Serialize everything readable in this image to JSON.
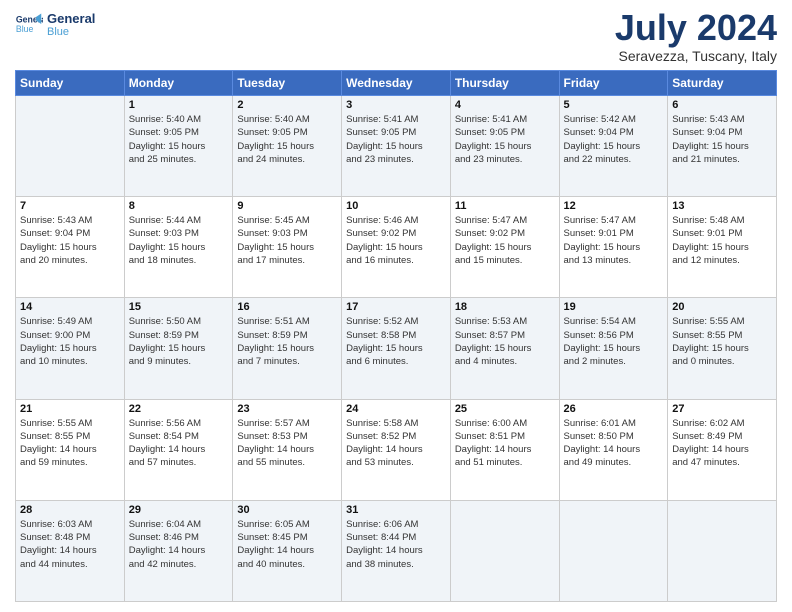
{
  "header": {
    "logo_line1": "General",
    "logo_line2": "Blue",
    "main_title": "July 2024",
    "subtitle": "Seravezza, Tuscany, Italy"
  },
  "weekdays": [
    "Sunday",
    "Monday",
    "Tuesday",
    "Wednesday",
    "Thursday",
    "Friday",
    "Saturday"
  ],
  "weeks": [
    [
      {
        "day": "",
        "info": ""
      },
      {
        "day": "1",
        "info": "Sunrise: 5:40 AM\nSunset: 9:05 PM\nDaylight: 15 hours\nand 25 minutes."
      },
      {
        "day": "2",
        "info": "Sunrise: 5:40 AM\nSunset: 9:05 PM\nDaylight: 15 hours\nand 24 minutes."
      },
      {
        "day": "3",
        "info": "Sunrise: 5:41 AM\nSunset: 9:05 PM\nDaylight: 15 hours\nand 23 minutes."
      },
      {
        "day": "4",
        "info": "Sunrise: 5:41 AM\nSunset: 9:05 PM\nDaylight: 15 hours\nand 23 minutes."
      },
      {
        "day": "5",
        "info": "Sunrise: 5:42 AM\nSunset: 9:04 PM\nDaylight: 15 hours\nand 22 minutes."
      },
      {
        "day": "6",
        "info": "Sunrise: 5:43 AM\nSunset: 9:04 PM\nDaylight: 15 hours\nand 21 minutes."
      }
    ],
    [
      {
        "day": "7",
        "info": "Sunrise: 5:43 AM\nSunset: 9:04 PM\nDaylight: 15 hours\nand 20 minutes."
      },
      {
        "day": "8",
        "info": "Sunrise: 5:44 AM\nSunset: 9:03 PM\nDaylight: 15 hours\nand 18 minutes."
      },
      {
        "day": "9",
        "info": "Sunrise: 5:45 AM\nSunset: 9:03 PM\nDaylight: 15 hours\nand 17 minutes."
      },
      {
        "day": "10",
        "info": "Sunrise: 5:46 AM\nSunset: 9:02 PM\nDaylight: 15 hours\nand 16 minutes."
      },
      {
        "day": "11",
        "info": "Sunrise: 5:47 AM\nSunset: 9:02 PM\nDaylight: 15 hours\nand 15 minutes."
      },
      {
        "day": "12",
        "info": "Sunrise: 5:47 AM\nSunset: 9:01 PM\nDaylight: 15 hours\nand 13 minutes."
      },
      {
        "day": "13",
        "info": "Sunrise: 5:48 AM\nSunset: 9:01 PM\nDaylight: 15 hours\nand 12 minutes."
      }
    ],
    [
      {
        "day": "14",
        "info": "Sunrise: 5:49 AM\nSunset: 9:00 PM\nDaylight: 15 hours\nand 10 minutes."
      },
      {
        "day": "15",
        "info": "Sunrise: 5:50 AM\nSunset: 8:59 PM\nDaylight: 15 hours\nand 9 minutes."
      },
      {
        "day": "16",
        "info": "Sunrise: 5:51 AM\nSunset: 8:59 PM\nDaylight: 15 hours\nand 7 minutes."
      },
      {
        "day": "17",
        "info": "Sunrise: 5:52 AM\nSunset: 8:58 PM\nDaylight: 15 hours\nand 6 minutes."
      },
      {
        "day": "18",
        "info": "Sunrise: 5:53 AM\nSunset: 8:57 PM\nDaylight: 15 hours\nand 4 minutes."
      },
      {
        "day": "19",
        "info": "Sunrise: 5:54 AM\nSunset: 8:56 PM\nDaylight: 15 hours\nand 2 minutes."
      },
      {
        "day": "20",
        "info": "Sunrise: 5:55 AM\nSunset: 8:55 PM\nDaylight: 15 hours\nand 0 minutes."
      }
    ],
    [
      {
        "day": "21",
        "info": "Sunrise: 5:55 AM\nSunset: 8:55 PM\nDaylight: 14 hours\nand 59 minutes."
      },
      {
        "day": "22",
        "info": "Sunrise: 5:56 AM\nSunset: 8:54 PM\nDaylight: 14 hours\nand 57 minutes."
      },
      {
        "day": "23",
        "info": "Sunrise: 5:57 AM\nSunset: 8:53 PM\nDaylight: 14 hours\nand 55 minutes."
      },
      {
        "day": "24",
        "info": "Sunrise: 5:58 AM\nSunset: 8:52 PM\nDaylight: 14 hours\nand 53 minutes."
      },
      {
        "day": "25",
        "info": "Sunrise: 6:00 AM\nSunset: 8:51 PM\nDaylight: 14 hours\nand 51 minutes."
      },
      {
        "day": "26",
        "info": "Sunrise: 6:01 AM\nSunset: 8:50 PM\nDaylight: 14 hours\nand 49 minutes."
      },
      {
        "day": "27",
        "info": "Sunrise: 6:02 AM\nSunset: 8:49 PM\nDaylight: 14 hours\nand 47 minutes."
      }
    ],
    [
      {
        "day": "28",
        "info": "Sunrise: 6:03 AM\nSunset: 8:48 PM\nDaylight: 14 hours\nand 44 minutes."
      },
      {
        "day": "29",
        "info": "Sunrise: 6:04 AM\nSunset: 8:46 PM\nDaylight: 14 hours\nand 42 minutes."
      },
      {
        "day": "30",
        "info": "Sunrise: 6:05 AM\nSunset: 8:45 PM\nDaylight: 14 hours\nand 40 minutes."
      },
      {
        "day": "31",
        "info": "Sunrise: 6:06 AM\nSunset: 8:44 PM\nDaylight: 14 hours\nand 38 minutes."
      },
      {
        "day": "",
        "info": ""
      },
      {
        "day": "",
        "info": ""
      },
      {
        "day": "",
        "info": ""
      }
    ]
  ]
}
